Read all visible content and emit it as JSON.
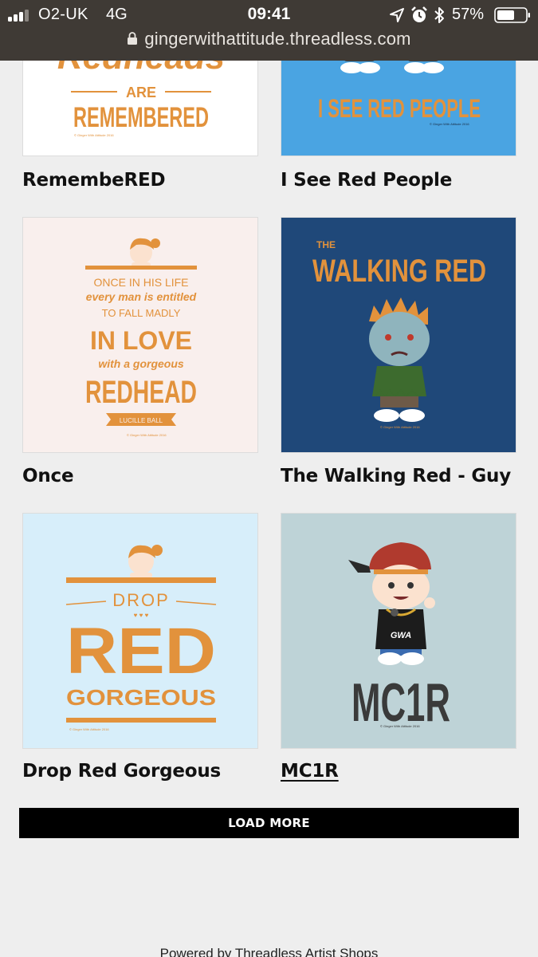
{
  "status_bar": {
    "carrier": "O2-UK",
    "network": "4G",
    "time": "09:41",
    "battery_percent": "57%",
    "icons": [
      "signal-icon",
      "location-arrow-icon",
      "alarm-clock-icon",
      "bluetooth-icon",
      "battery-icon"
    ]
  },
  "browser": {
    "url": "gingerwithattitude.threadless.com"
  },
  "products": [
    {
      "title": "RemembeRED",
      "art_lines": [
        "Redheads",
        "ARE",
        "REMEMBERED"
      ],
      "credit": "© Ginger With Attitude 2016",
      "bg": "#ffffff"
    },
    {
      "title": "I See Red People",
      "art_lines": [
        "I SEE RED PEOPLE"
      ],
      "credit": "© Ginger With Attitude 2016",
      "bg": "#4aa4e2"
    },
    {
      "title": "Once",
      "art_lines": [
        "ONCE IN HIS LIFE",
        "every man is entitled",
        "TO FALL MADLY",
        "IN LOVE",
        "with a gorgeous",
        "REDHEAD",
        "LUCILLE BALL"
      ],
      "credit": "© Ginger With Attitude 2016",
      "bg": "#f9efed"
    },
    {
      "title": "The Walking Red - Guy",
      "art_lines": [
        "THE",
        "WALKING RED"
      ],
      "credit": "© Ginger With Attitude 2016",
      "bg": "#1f4879"
    },
    {
      "title": "Drop Red Gorgeous",
      "art_lines": [
        "DROP",
        "RED",
        "GORGEOUS"
      ],
      "credit": "© Ginger With Attitude 2016",
      "bg": "#d7eefa"
    },
    {
      "title": "MC1R",
      "art_lines": [
        "GWA",
        "MC1R"
      ],
      "credit": "© Ginger With Attitude 2016",
      "bg": "#bed3d7"
    }
  ],
  "load_more_label": "LOAD MORE",
  "footer": {
    "powered_by": "Powered by Threadless Artist Shops"
  },
  "colors": {
    "accent_orange": "#e2923c",
    "page_bg": "#eeeeee",
    "topbar_bg": "#3f3a35"
  }
}
